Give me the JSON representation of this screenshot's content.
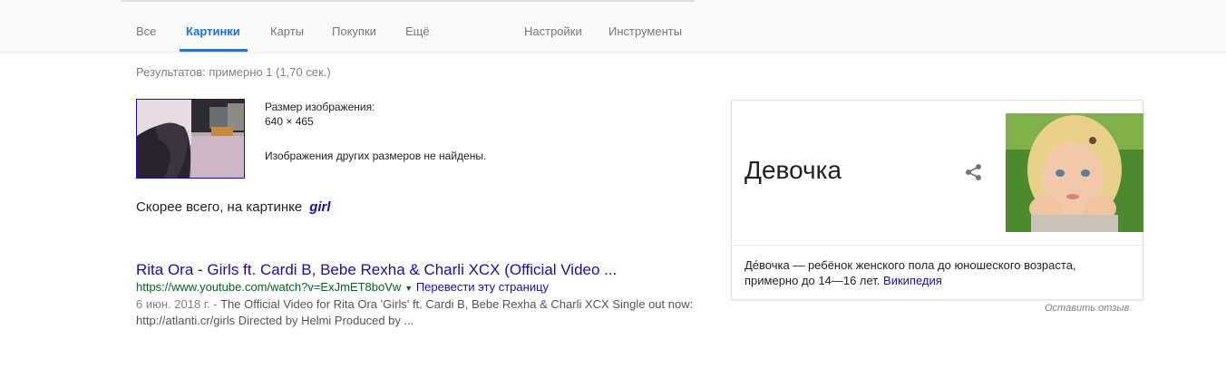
{
  "tabs": [
    {
      "label": "Все"
    },
    {
      "label": "Картинки"
    },
    {
      "label": "Карты"
    },
    {
      "label": "Покупки"
    },
    {
      "label": "Ещё"
    }
  ],
  "tools": {
    "settings_label": "Настройки",
    "tools_label": "Инструменты"
  },
  "result_stats": "Результатов: примерно 1 (1,70 сек.)",
  "image_info": {
    "size_label": "Размер изображения:",
    "size_value": "640 × 465",
    "no_other_sizes": "Изображения других размеров не найдены."
  },
  "best_guess": {
    "prefix": "Скорее всего, на картинке",
    "query": "girl"
  },
  "result": {
    "title": "Rita Ora - Girls ft. Cardi B, Bebe Rexha & Charli XCX (Official Video ...",
    "url": "https://www.youtube.com/watch?v=ExJmET8boVw",
    "arrow": "▼",
    "translate": "Перевести эту страницу",
    "date": "6 июн. 2018 г. - ",
    "snippet": "The Official Video for Rita Ora 'Girls' ft. Cardi B, Bebe Rexha & Charli XCX Single out now: http://atlanti.cr/girls Directed by Helmi Produced by ..."
  },
  "knowledge_panel": {
    "title": "Девочка",
    "description": "Де́вочка — ребёнок женского пола до юношеского возраста, примерно до 14—16 лет.",
    "source_link": "Википедия"
  },
  "feedback": "Оставить отзыв",
  "colors": {
    "link": "#1a0dab",
    "url_green": "#006621",
    "active_tab": "#1a73e8"
  }
}
